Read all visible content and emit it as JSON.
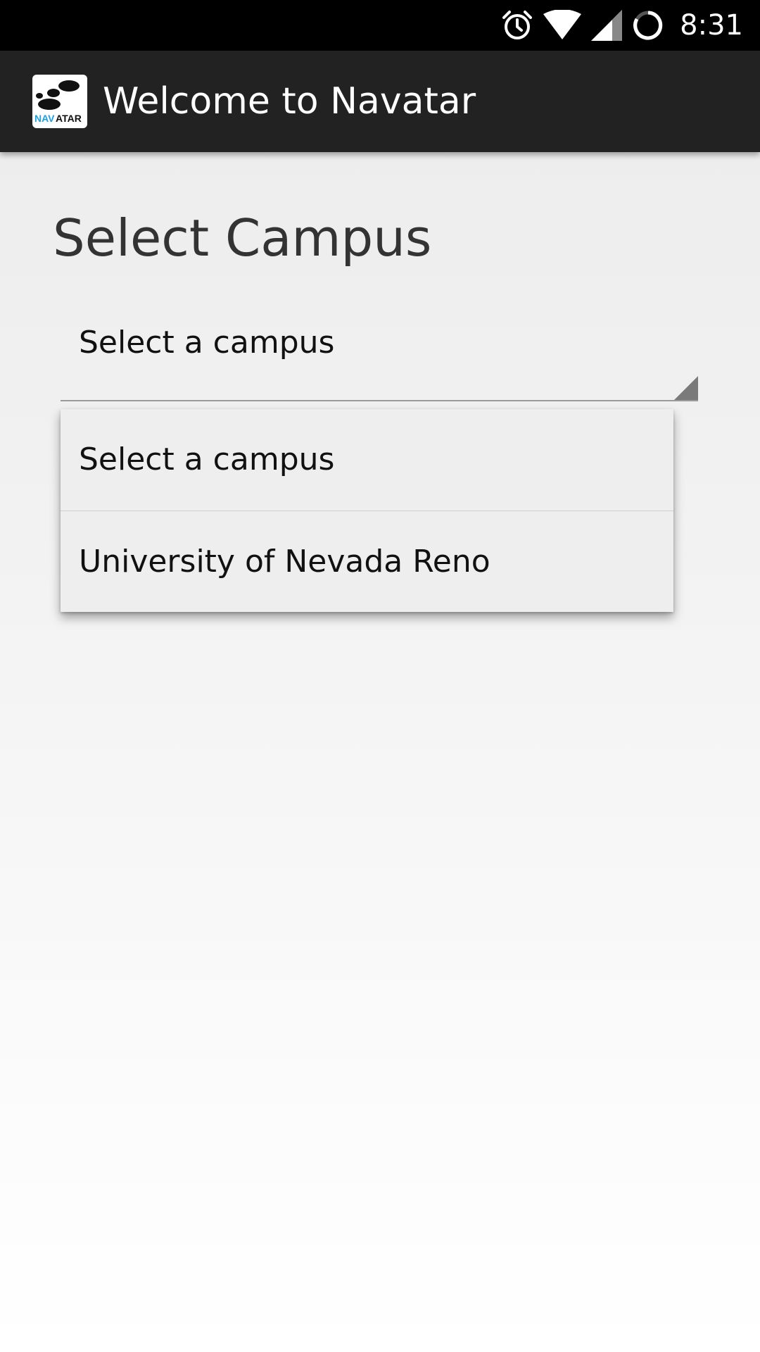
{
  "status_bar": {
    "time": "8:31",
    "icons": [
      "alarm-icon",
      "wifi-icon",
      "cell-signal-icon",
      "sync-icon"
    ]
  },
  "app_bar": {
    "title": "Welcome to Navatar",
    "logo_text_nav": "NAV",
    "logo_text_atar": "ATAR"
  },
  "main": {
    "section_title": "Select Campus",
    "spinner": {
      "selected_value": "Select a campus"
    },
    "dropdown": {
      "options": [
        {
          "label": "Select a campus"
        },
        {
          "label": "University of Nevada Reno"
        }
      ]
    }
  },
  "colors": {
    "status_bar": "#000000",
    "app_bar": "#222222",
    "logo_accent": "#1ea0dc"
  }
}
